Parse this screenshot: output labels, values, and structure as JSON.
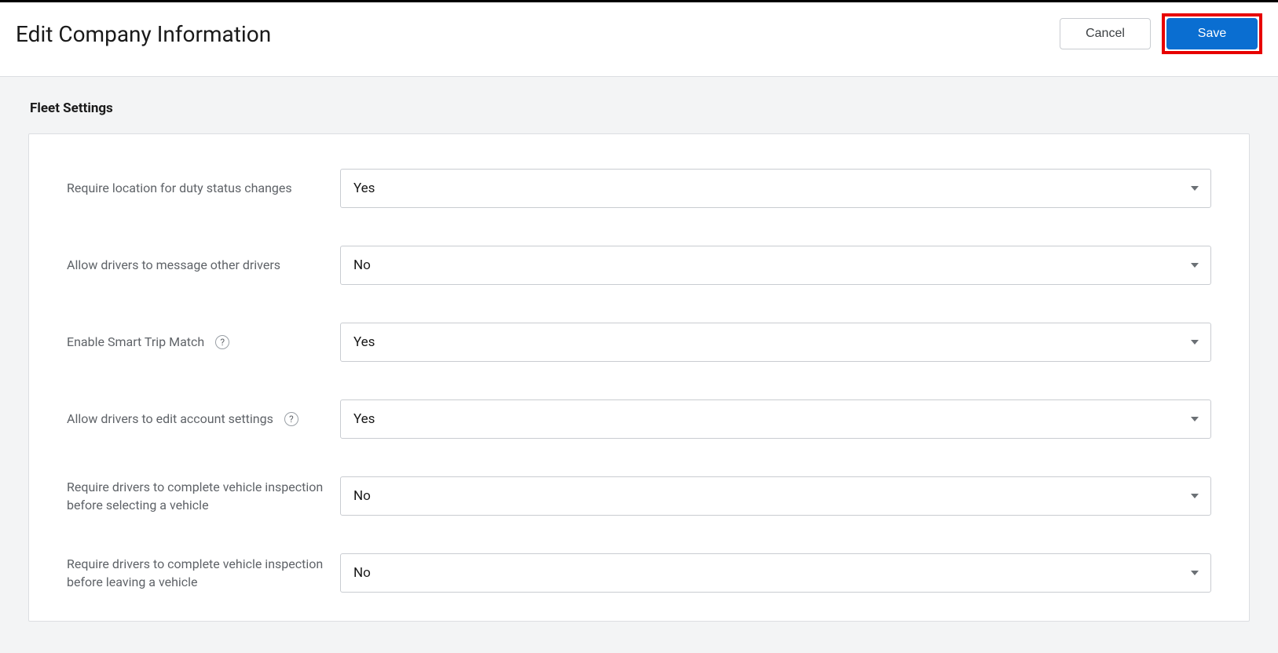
{
  "header": {
    "title": "Edit Company Information",
    "cancel_label": "Cancel",
    "save_label": "Save"
  },
  "section": {
    "title": "Fleet Settings"
  },
  "fields": [
    {
      "label": "Require location for duty status changes",
      "value": "Yes",
      "help": false
    },
    {
      "label": "Allow drivers to message other drivers",
      "value": "No",
      "help": false
    },
    {
      "label": "Enable Smart Trip Match",
      "value": "Yes",
      "help": true
    },
    {
      "label": "Allow drivers to edit account settings",
      "value": "Yes",
      "help": true
    },
    {
      "label": "Require drivers to complete vehicle inspection before selecting a vehicle",
      "value": "No",
      "help": false
    },
    {
      "label": "Require drivers to complete vehicle inspection before leaving a vehicle",
      "value": "No",
      "help": false
    }
  ],
  "colors": {
    "primary": "#0a6ed1",
    "highlight_border": "#e70000"
  }
}
